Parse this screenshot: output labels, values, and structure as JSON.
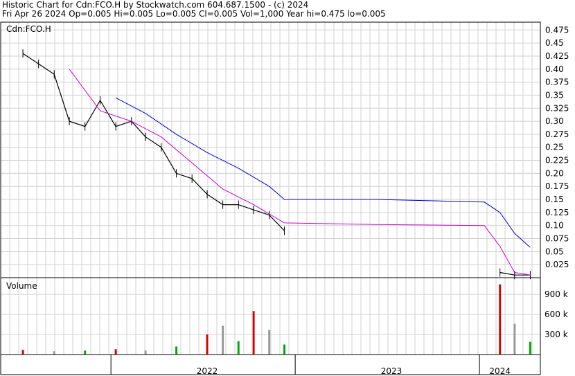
{
  "header": {
    "line1": "Historic Chart for Cdn:FCO.H by Stockwatch.com 604.687.1500 - (c) 2024",
    "line2": "Fri Apr 26 2024   Op=0.005   Hi=0.005   Lo=0.005   Cl=0.005   Vol=1,000   Year hi=0.475   lo=0.005"
  },
  "chart_data": [
    {
      "type": "line",
      "title": "Cdn:FCO.H",
      "y_axis_side": "right",
      "ylim": [
        0.0,
        0.49
      ],
      "y_ticks": [
        "0.475",
        "0.45",
        "0.425",
        "0.40",
        "0.375",
        "0.35",
        "0.325",
        "0.30",
        "0.275",
        "0.25",
        "0.225",
        "0.20",
        "0.175",
        "0.15",
        "0.125",
        "0.10",
        "0.075",
        "0.05",
        "0.025"
      ],
      "grid": true,
      "colors": {
        "price": "#000000",
        "ma_short": "#cc00cc",
        "ma_long": "#0000cc"
      },
      "series": [
        {
          "role": "price",
          "x": [
            "2021-07",
            "2021-08",
            "2021-09",
            "2021-10",
            "2021-11",
            "2021-12",
            "2022-01",
            "2022-02",
            "2022-03",
            "2022-04",
            "2022-05",
            "2022-06",
            "2022-07",
            "2022-08",
            "2022-09",
            "2022-10",
            "2022-11",
            "2022-12",
            "2024-02",
            "2024-03",
            "2024-04"
          ],
          "values": [
            0.43,
            0.41,
            0.39,
            0.3,
            0.29,
            0.34,
            0.29,
            0.3,
            0.27,
            0.25,
            0.2,
            0.19,
            0.16,
            0.14,
            0.14,
            0.13,
            0.12,
            0.09,
            0.01,
            0.005,
            0.005
          ]
        },
        {
          "role": "ma_short",
          "x": [
            "2021-10",
            "2021-12",
            "2022-02",
            "2022-04",
            "2022-06",
            "2022-08",
            "2022-10",
            "2022-12",
            "2023-06",
            "2024-01",
            "2024-02",
            "2024-03",
            "2024-04"
          ],
          "values": [
            0.4,
            0.32,
            0.3,
            0.27,
            0.22,
            0.17,
            0.14,
            0.105,
            0.102,
            0.1,
            0.06,
            0.01,
            0.005
          ]
        },
        {
          "role": "ma_long",
          "x": [
            "2022-01",
            "2022-03",
            "2022-05",
            "2022-07",
            "2022-09",
            "2022-11",
            "2022-12",
            "2023-06",
            "2024-01",
            "2024-02",
            "2024-03",
            "2024-04"
          ],
          "values": [
            0.345,
            0.315,
            0.275,
            0.24,
            0.21,
            0.175,
            0.15,
            0.15,
            0.145,
            0.125,
            0.085,
            0.058
          ]
        }
      ]
    },
    {
      "type": "bar",
      "title": "Volume",
      "y_axis_side": "right",
      "ylim": [
        0,
        1150000
      ],
      "y_ticks": [
        "900 k",
        "600 k",
        "300 k"
      ],
      "grid": true,
      "x_ticks": [
        "2022",
        "2023",
        "2024"
      ],
      "colors": {
        "up": "#00aa00",
        "down": "#dd0000",
        "flat": "#999999"
      },
      "x": [
        "2021-07",
        "2021-09",
        "2021-11",
        "2022-01",
        "2022-03",
        "2022-05",
        "2022-07",
        "2022-08",
        "2022-09",
        "2022-10",
        "2022-11",
        "2022-12",
        "2024-02",
        "2024-03",
        "2024-04"
      ],
      "values": [
        70000,
        50000,
        60000,
        80000,
        60000,
        120000,
        300000,
        430000,
        200000,
        650000,
        370000,
        150000,
        1050000,
        460000,
        190000
      ]
    }
  ]
}
